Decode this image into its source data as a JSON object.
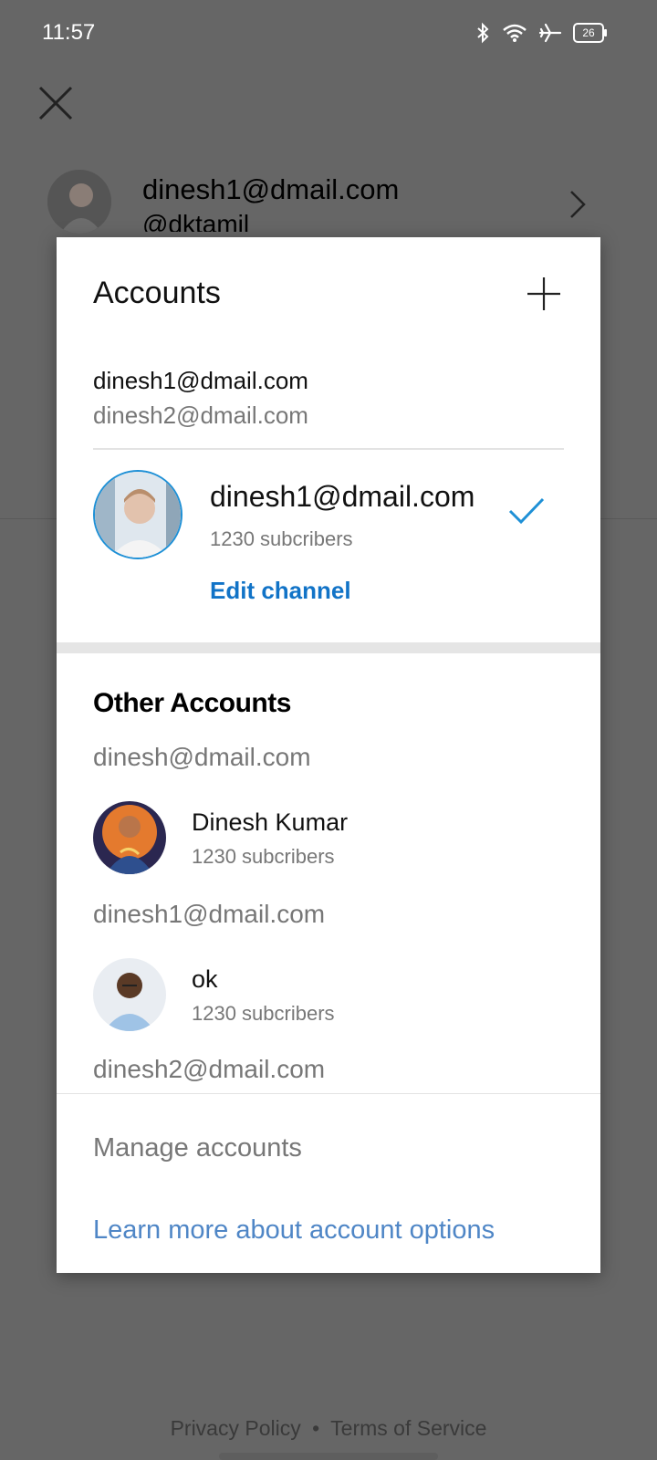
{
  "status_bar": {
    "time": "11:57",
    "battery": "26",
    "icons": [
      "bluetooth-icon",
      "wifi-icon",
      "airplane-icon",
      "battery-icon"
    ]
  },
  "background": {
    "account_email": "dinesh1@dmail.com",
    "account_handle": "@dktamil",
    "footer": {
      "privacy": "Privacy Policy",
      "separator": "•",
      "terms": "Terms of Service"
    }
  },
  "dialog": {
    "title": "Accounts",
    "signed_in": {
      "primary": "dinesh1@dmail.com",
      "secondary": "dinesh2@dmail.com"
    },
    "current_channel": {
      "name": "dinesh1@dmail.com",
      "subscribers": "1230 subcribers",
      "edit_label": "Edit channel"
    },
    "other_heading": "Other Accounts",
    "other_accounts": [
      {
        "email": "dinesh@dmail.com",
        "channel_name": "Dinesh Kumar",
        "subscribers": "1230 subcribers"
      },
      {
        "email": "dinesh1@dmail.com",
        "channel_name": "ok",
        "subscribers": "1230 subcribers"
      },
      {
        "email": "dinesh2@dmail.com"
      }
    ],
    "manage_label": "Manage accounts",
    "learn_more_label": "Learn more about account options"
  },
  "colors": {
    "accent_blue": "#1173c7",
    "link_blue": "#4f86c6",
    "check_blue": "#1e90d6",
    "scrim": "#666666"
  }
}
